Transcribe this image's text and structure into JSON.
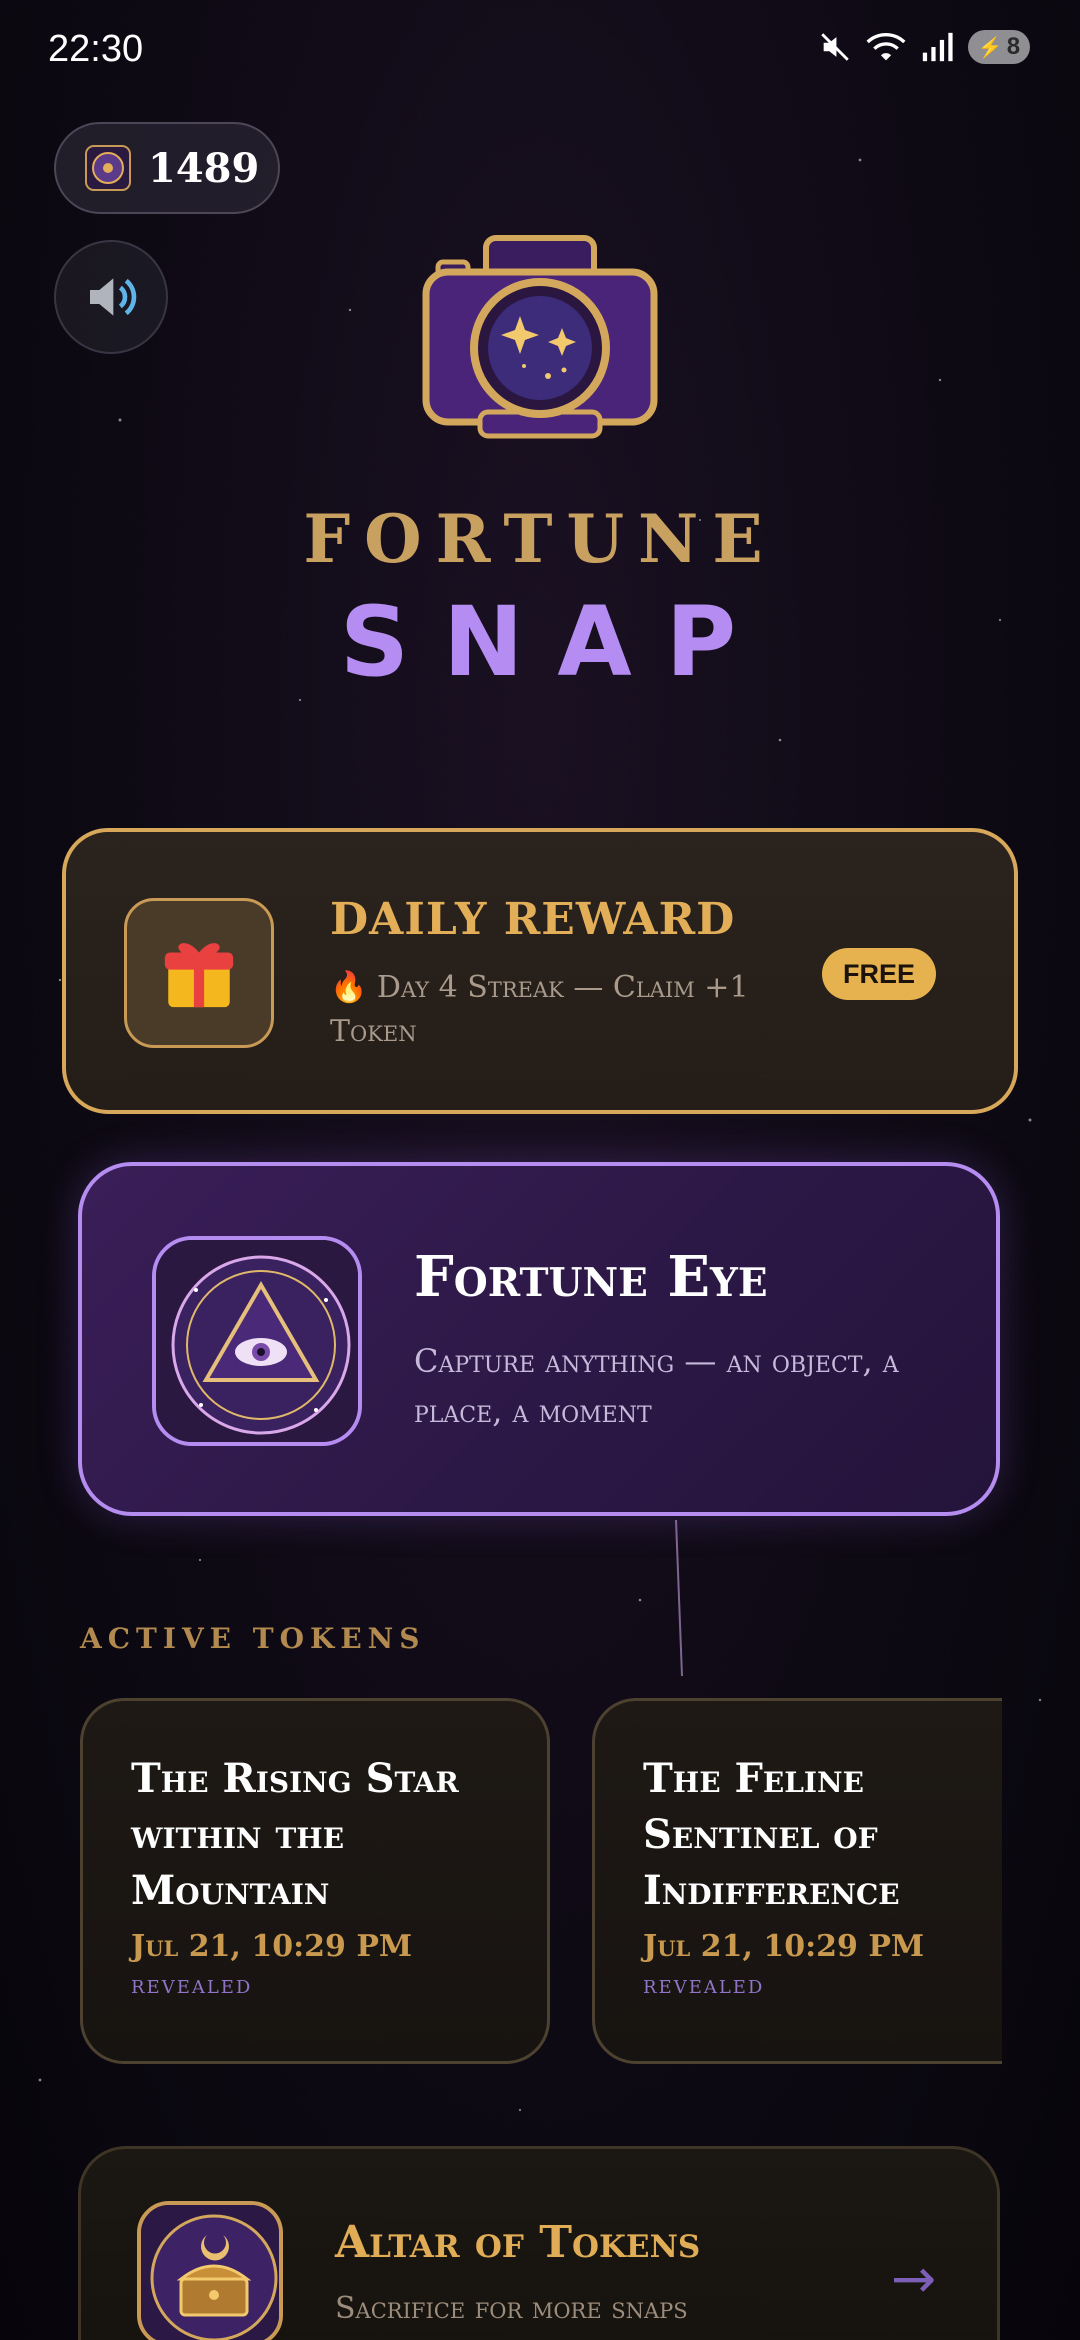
{
  "status_bar": {
    "time": "22:30",
    "battery": "8",
    "icons": [
      "mute-icon",
      "wifi-icon",
      "signal-icon",
      "battery-icon"
    ]
  },
  "header": {
    "token_count": "1489",
    "token_icon": "token-coin-icon",
    "sound_icon": "speaker-icon"
  },
  "title": {
    "line1": "FORTUNE",
    "line2": "SNAP"
  },
  "daily_reward": {
    "title": "DAILY REWARD",
    "subtitle": "🔥 Day 4 Streak — Claim +1 Token",
    "badge": "FREE",
    "icon": "gift-icon"
  },
  "fortune_eye": {
    "title": "Fortune Eye",
    "subtitle": "Capture anything — an object, a place, a moment",
    "icon": "all-seeing-eye-icon"
  },
  "active_tokens": {
    "heading": "ACTIVE TOKENS",
    "items": [
      {
        "title": "The Rising Star within the Mountain",
        "date": "Jul 21, 10:29 PM",
        "status": "revealed"
      },
      {
        "title": "The Feline Sentinel of Indifference",
        "date": "Jul 21, 10:29 PM",
        "status": "revealed"
      }
    ]
  },
  "altar": {
    "title": "Altar of Tokens",
    "subtitle": "Sacrifice for more snaps",
    "arrow": "→",
    "icon": "altar-chest-icon"
  },
  "colors": {
    "gold": "#c8a060",
    "purple": "#b48cf2",
    "background": "#0e0a14"
  }
}
